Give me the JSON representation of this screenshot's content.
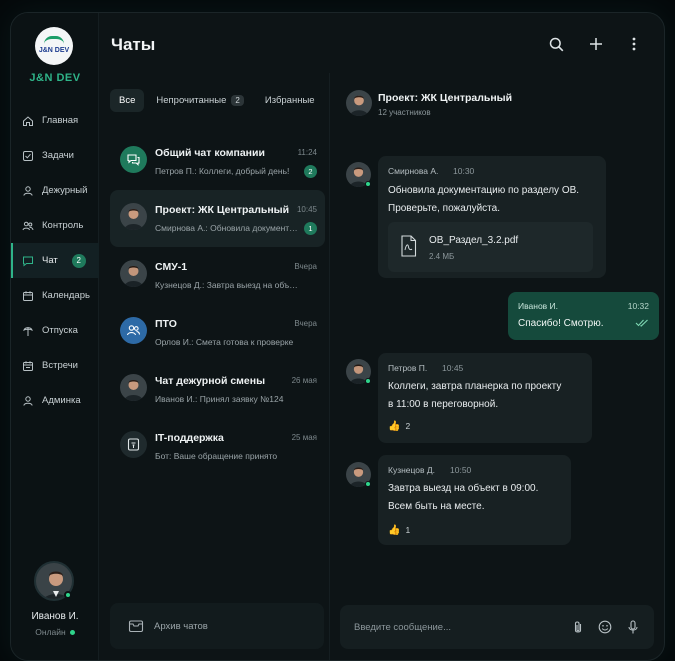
{
  "brand": {
    "logo_text": "J&N DEV",
    "name": "J&N DEV",
    "accent": "#2fb489"
  },
  "sidebar": {
    "items": [
      {
        "label": "Главная",
        "icon": "home-icon"
      },
      {
        "label": "Задачи",
        "icon": "tasks-icon"
      },
      {
        "label": "Дежурный",
        "icon": "duty-icon"
      },
      {
        "label": "Контроль",
        "icon": "control-icon"
      },
      {
        "label": "Чат",
        "icon": "chat-icon",
        "badge": "2",
        "active": true
      },
      {
        "label": "Календарь",
        "icon": "calendar-icon"
      },
      {
        "label": "Отпуска",
        "icon": "vacation-icon"
      },
      {
        "label": "Встречи",
        "icon": "meetings-icon"
      },
      {
        "label": "Админка",
        "icon": "admin-icon"
      }
    ],
    "profile": {
      "name": "Иванов И.",
      "status": "Онлайн"
    }
  },
  "header": {
    "title": "Чаты"
  },
  "tabs": [
    {
      "label": "Все",
      "active": true
    },
    {
      "label": "Непрочитанные",
      "count": "2"
    },
    {
      "label": "Избранные"
    }
  ],
  "chats": [
    {
      "name": "Общий чат компании",
      "preview": "Петров П.: Коллеги, добрый день!",
      "time": "11:24",
      "badge": "2",
      "avatar": "group-icon"
    },
    {
      "name": "Проект: ЖК Центральный",
      "preview": "Смирнова А.: Обновила документацию",
      "time": "10:45",
      "badge": "1",
      "avatar": "person-avatar",
      "active": true
    },
    {
      "name": "СМУ-1",
      "preview": "Кузнецов Д.: Завтра выезд на объект",
      "time": "Вчера",
      "avatar": "person-avatar"
    },
    {
      "name": "ПТО",
      "preview": "Орлов И.: Смета готова к проверке",
      "time": "Вчера",
      "avatar": "users-icon"
    },
    {
      "name": "Чат дежурной смены",
      "preview": "Иванов И.: Принял заявку №124",
      "time": "26 мая",
      "avatar": "person-avatar"
    },
    {
      "name": "IT-поддержка",
      "preview": "Бот: Ваше обращение принято",
      "time": "25 мая",
      "avatar": "support-icon"
    }
  ],
  "archive": {
    "label": "Архив чатов"
  },
  "conversation": {
    "title": "Проект: ЖК Центральный",
    "subtitle": "12 участников",
    "messages": [
      {
        "author": "Смирнова А.",
        "time": "10:30",
        "line1": "Обновила документацию по разделу ОВ.",
        "line2": "Проверьте, пожалуйста.",
        "file": {
          "name": "ОВ_Раздел_3.2.pdf",
          "size": "2.4 МБ"
        }
      },
      {
        "author": "Иванов И.",
        "time": "10:32",
        "text": "Спасибо! Смотрю.",
        "outgoing": true
      },
      {
        "author": "Петров П.",
        "time": "10:45",
        "line1": "Коллеги, завтра планерка по проекту",
        "line2": "в 11:00 в переговорной.",
        "reaction": {
          "emoji": "👍",
          "count": "2"
        }
      },
      {
        "author": "Кузнецов Д.",
        "time": "10:50",
        "line1": "Завтра выезд на объект в 09:00.",
        "line2": "Всем быть на месте.",
        "reaction": {
          "emoji": "👍",
          "count": "1"
        }
      }
    ],
    "composer": {
      "placeholder": "Введите сообщение..."
    }
  }
}
